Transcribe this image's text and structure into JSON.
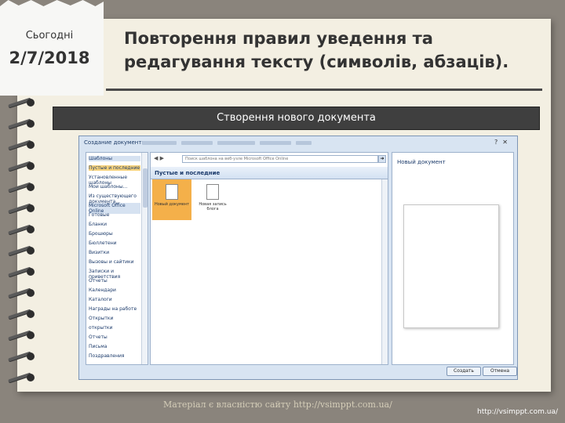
{
  "date_note": {
    "label": "Сьогодні",
    "value": "2/7/2018"
  },
  "title": "Повторення правил уведення та редагування тексту (символів, абзаців).",
  "section_heading": "Створення нового документа",
  "dialog": {
    "title": "Создание документа",
    "nav_items": [
      {
        "label": "Шаблоны",
        "style": "hdr"
      },
      {
        "label": "Пустые и последние",
        "style": "sel"
      },
      {
        "label": "Установленные шаблоны",
        "style": ""
      },
      {
        "label": "Мои шаблоны...",
        "style": ""
      },
      {
        "label": "Из существующего документа...",
        "style": ""
      },
      {
        "label": "Microsoft Office Online",
        "style": "hdr"
      },
      {
        "label": "Готовые",
        "style": ""
      },
      {
        "label": "Бланки",
        "style": ""
      },
      {
        "label": "Брошюры",
        "style": ""
      },
      {
        "label": "Бюллетени",
        "style": ""
      },
      {
        "label": "Визитки",
        "style": ""
      },
      {
        "label": "Вызовы и сайтики",
        "style": ""
      },
      {
        "label": "Записки и приветствия",
        "style": ""
      },
      {
        "label": "Отчеты",
        "style": ""
      },
      {
        "label": "Календари",
        "style": ""
      },
      {
        "label": "Каталоги",
        "style": ""
      },
      {
        "label": "Награды на работе",
        "style": ""
      },
      {
        "label": "Открытки",
        "style": ""
      },
      {
        "label": "открытки",
        "style": ""
      },
      {
        "label": "Отчеты",
        "style": ""
      },
      {
        "label": "Письма",
        "style": ""
      },
      {
        "label": "Поздравления",
        "style": ""
      }
    ],
    "search_placeholder": "Поиск шаблона на веб-узле Microsoft Office Online",
    "group_heading": "Пустые и последние",
    "tiles": [
      {
        "label": "Новый документ",
        "selected": true
      },
      {
        "label": "Новая запись блога",
        "selected": false
      }
    ],
    "preview_title": "Новый документ",
    "create_button": "Создать",
    "cancel_button": "Отмена"
  },
  "footer": "Матеріал є власністю сайту http://vsimppt.com.ua/",
  "site_link": "http://vsimppt.com.ua/"
}
